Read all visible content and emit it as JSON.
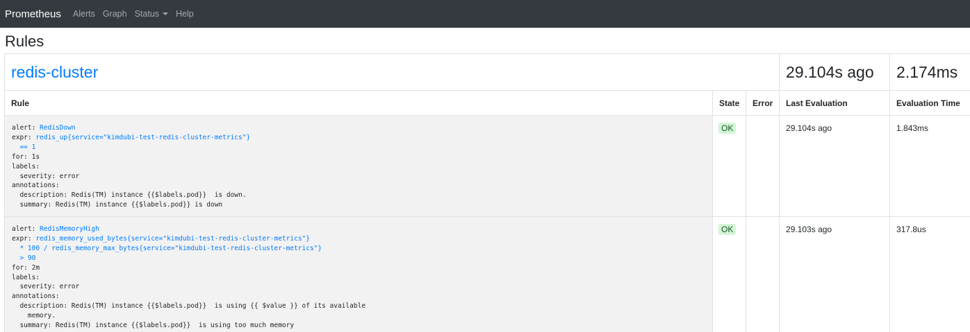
{
  "nav": {
    "brand": "Prometheus",
    "alerts": "Alerts",
    "graph": "Graph",
    "status": "Status",
    "help": "Help"
  },
  "page_title": "Rules",
  "group": {
    "name": "redis-cluster",
    "last_evaluation": "29.104s ago",
    "evaluation_time": "2.174ms"
  },
  "columns": {
    "rule": "Rule",
    "state": "State",
    "error": "Error",
    "last_evaluation": "Last Evaluation",
    "evaluation_time": "Evaluation Time"
  },
  "rules": [
    {
      "alert_key": "alert: ",
      "alert_name": "RedisDown",
      "expr_key": "expr: ",
      "expr_lines": [
        "redis_up{service=\"kimdubi-test-redis-cluster-metrics\"}",
        "  == 1"
      ],
      "for_line": "for: 1s",
      "labels_line": "labels:",
      "severity_line": "  severity: error",
      "annotations_line": "annotations:",
      "description_lines": [
        "  description: Redis(TM) instance {{$labels.pod}}  is down."
      ],
      "summary_line": "  summary: Redis(TM) instance {{$labels.pod}} is down",
      "state": "OK",
      "error": "",
      "last_evaluation": "29.104s ago",
      "evaluation_time": "1.843ms"
    },
    {
      "alert_key": "alert: ",
      "alert_name": "RedisMemoryHigh",
      "expr_key": "expr: ",
      "expr_lines": [
        "redis_memory_used_bytes{service=\"kimdubi-test-redis-cluster-metrics\"}",
        "  * 100 / redis_memory_max_bytes{service=\"kimdubi-test-redis-cluster-metrics\"}",
        "  > 90"
      ],
      "for_line": "for: 2m",
      "labels_line": "labels:",
      "severity_line": "  severity: error",
      "annotations_line": "annotations:",
      "description_lines": [
        "  description: Redis(TM) instance {{$labels.pod}}  is using {{ $value }} of its available",
        "    memory."
      ],
      "summary_line": "  summary: Redis(TM) instance {{$labels.pod}}  is using too much memory",
      "state": "OK",
      "error": "",
      "last_evaluation": "29.103s ago",
      "evaluation_time": "317.8us"
    }
  ]
}
